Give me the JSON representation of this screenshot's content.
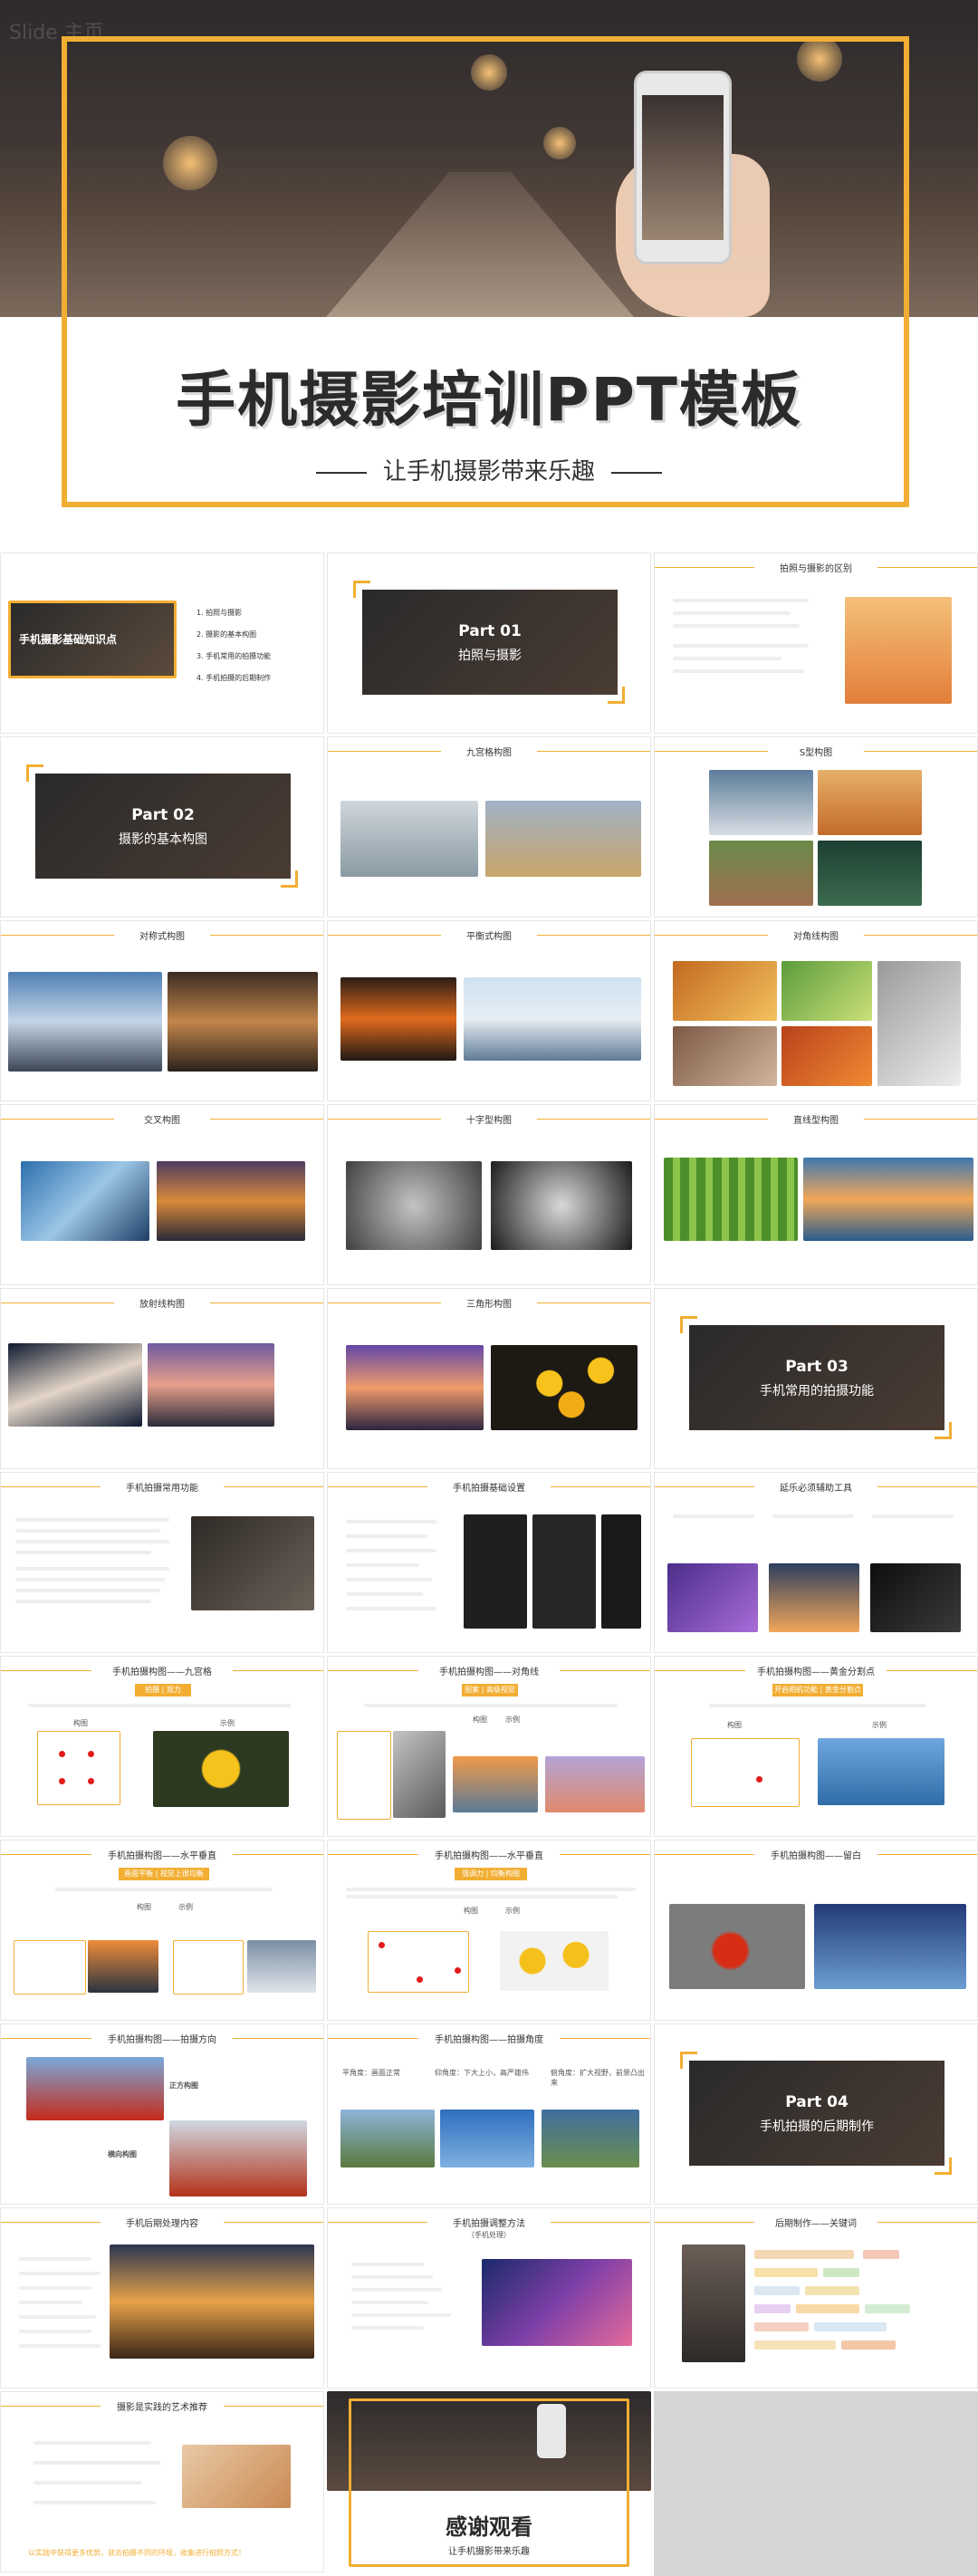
{
  "hero": {
    "title": "手机摄影培训PPT模板",
    "subtitle": "让手机摄影带来乐趣",
    "watermark": "Slide 主页"
  },
  "colors": {
    "accent": "#f2ae33",
    "dark": "#2b2b2b"
  },
  "slides": {
    "s1": {
      "title": "手机摄影基础知识点",
      "menu": [
        "1. 拍照与摄影",
        "2. 摄影的基本构图",
        "3. 手机常用的拍摄功能",
        "4. 手机拍摄的后期制作"
      ]
    },
    "s2": {
      "part": "Part 01",
      "name": "拍照与摄影"
    },
    "s3": {
      "title": "拍照与摄影的区别"
    },
    "s4": {
      "part": "Part 02",
      "name": "摄影的基本构图"
    },
    "s5": {
      "title": "九宫格构图"
    },
    "s6": {
      "title": "S型构图"
    },
    "s7": {
      "title": "对称式构图"
    },
    "s8": {
      "title": "平衡式构图"
    },
    "s9": {
      "title": "对角线构图"
    },
    "s10": {
      "title": "交叉构图"
    },
    "s11": {
      "title": "十字型构图"
    },
    "s12": {
      "title": "直线型构图"
    },
    "s13": {
      "title": "放射线构图"
    },
    "s14": {
      "title": "三角形构图"
    },
    "s15": {
      "part": "Part 03",
      "name": "手机常用的拍摄功能"
    },
    "s16": {
      "title": "手机拍摄常用功能"
    },
    "s17": {
      "title": "手机拍摄基础设置"
    },
    "s18": {
      "title": "延乐必须辅助工具"
    },
    "s19": {
      "title": "手机拍摄构图——九宫格",
      "tags": [
        "拍摄",
        "观力"
      ],
      "a": "构图",
      "b": "示例"
    },
    "s20": {
      "title": "手机拍摄构图——对角线",
      "tags": [
        "图案",
        "高级视觉"
      ],
      "a": "构图",
      "b": "示例"
    },
    "s21": {
      "title": "手机拍摄构图——黄金分割点",
      "tags": [
        "开启相机功能",
        "黄金分割点"
      ],
      "a": "构图",
      "b": "示例"
    },
    "s22": {
      "title": "手机拍摄构图——水平垂直",
      "tags": [
        "画面平衡",
        "视觉上很均衡"
      ],
      "a": "构图",
      "b": "示例"
    },
    "s23": {
      "title": "手机拍摄构图——水平垂直",
      "tags": [
        "强调力",
        "均衡构图"
      ],
      "a": "构图",
      "b": "示例"
    },
    "s24": {
      "title": "手机拍摄构图——留白"
    },
    "s25": {
      "title": "手机拍摄构图——拍摄方向",
      "note1": "正方构图",
      "note2": "横向构图"
    },
    "s26": {
      "title": "手机拍摄构图——拍摄角度",
      "angles": [
        "平角度：画面正常",
        "仰角度：下大上小，高严雄伟",
        "俯角度：扩大视野，前景凸出来"
      ]
    },
    "s27": {
      "part": "Part 04",
      "name": "手机拍摄的后期制作"
    },
    "s28": {
      "title": "手机后期处理内容"
    },
    "s29": {
      "title": "手机拍摄调整方法",
      "sub": "（手机处理）"
    },
    "s30": {
      "title": "后期制作——关键词"
    },
    "s31": {
      "title": "摄影是实践的艺术推荐",
      "footer": "以实践中获得更多优势，就去拍摄不同的环境，收集进行拍照方式！"
    },
    "s32": {
      "title": "感谢观看",
      "sub": "让手机摄影带来乐趣"
    }
  }
}
